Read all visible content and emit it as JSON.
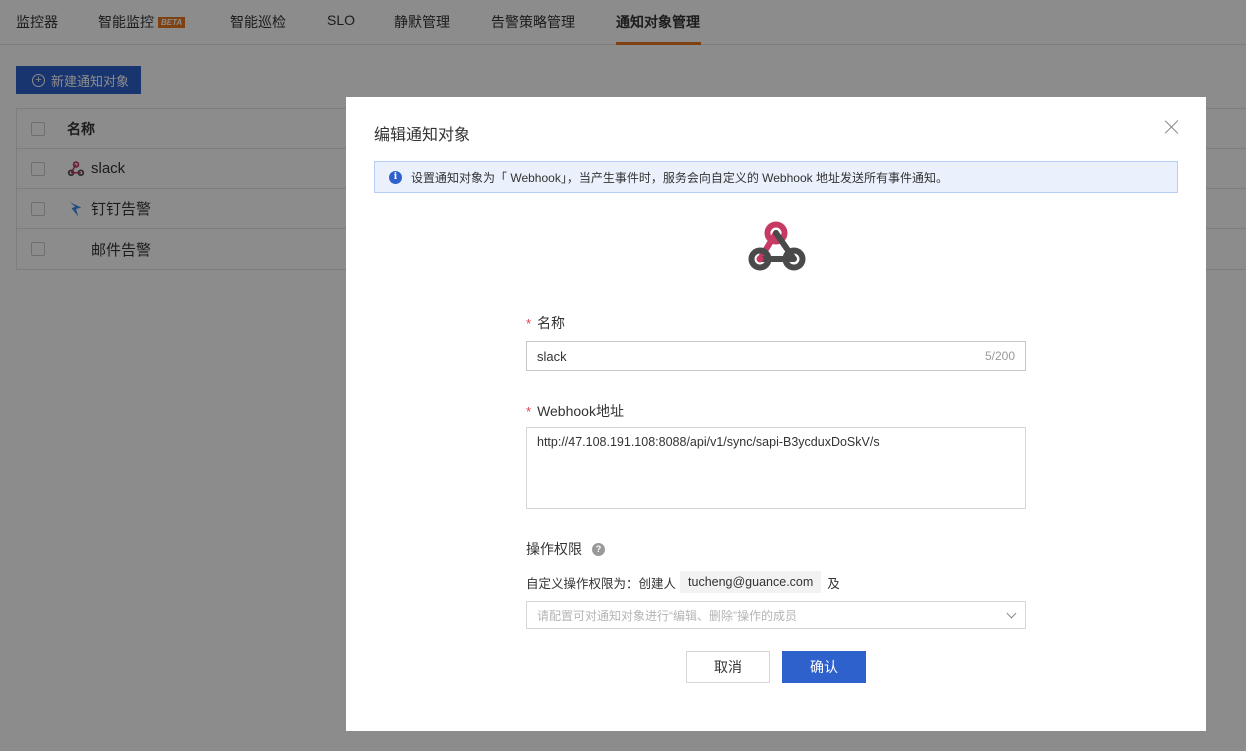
{
  "tabs": [
    {
      "label": "监控器"
    },
    {
      "label": "智能监控",
      "badge": "BETA"
    },
    {
      "label": "智能巡检"
    },
    {
      "label": "SLO"
    },
    {
      "label": "静默管理"
    },
    {
      "label": "告警策略管理"
    },
    {
      "label": "通知对象管理",
      "active": true
    }
  ],
  "toolbar": {
    "new_label": "新建通知对象"
  },
  "table": {
    "header": "名称",
    "rows": [
      {
        "name": "slack",
        "icon": "webhook-icon"
      },
      {
        "name": "钉钉告警",
        "icon": "dingtalk-icon"
      },
      {
        "name": "邮件告警",
        "icon": "none"
      }
    ]
  },
  "modal": {
    "title": "编辑通知对象",
    "info": "设置通知对象为「 Webhook」，当产生事件时，服务会向自定义的 Webhook 地址发送所有事件通知。",
    "logo_icon": "webhook-icon",
    "name_label": "名称",
    "name_value": "slack",
    "name_count": "5/200",
    "webhook_label": "Webhook地址",
    "webhook_value": "http://47.108.191.108:8088/api/v1/sync/sapi-B3ycduxDoSkV/s",
    "perm_label": "操作权限",
    "perm_text": "自定义操作权限为：创建人",
    "perm_user": "tucheng@guance.com",
    "perm_suffix": "及",
    "perm_placeholder": "请配置可对通知对象进行“编辑、删除”操作的成员",
    "cancel_label": "取消",
    "ok_label": "确认"
  },
  "colors": {
    "primary": "#2f61cc",
    "accent": "#e87722",
    "webhook_pink": "#c73a63"
  }
}
